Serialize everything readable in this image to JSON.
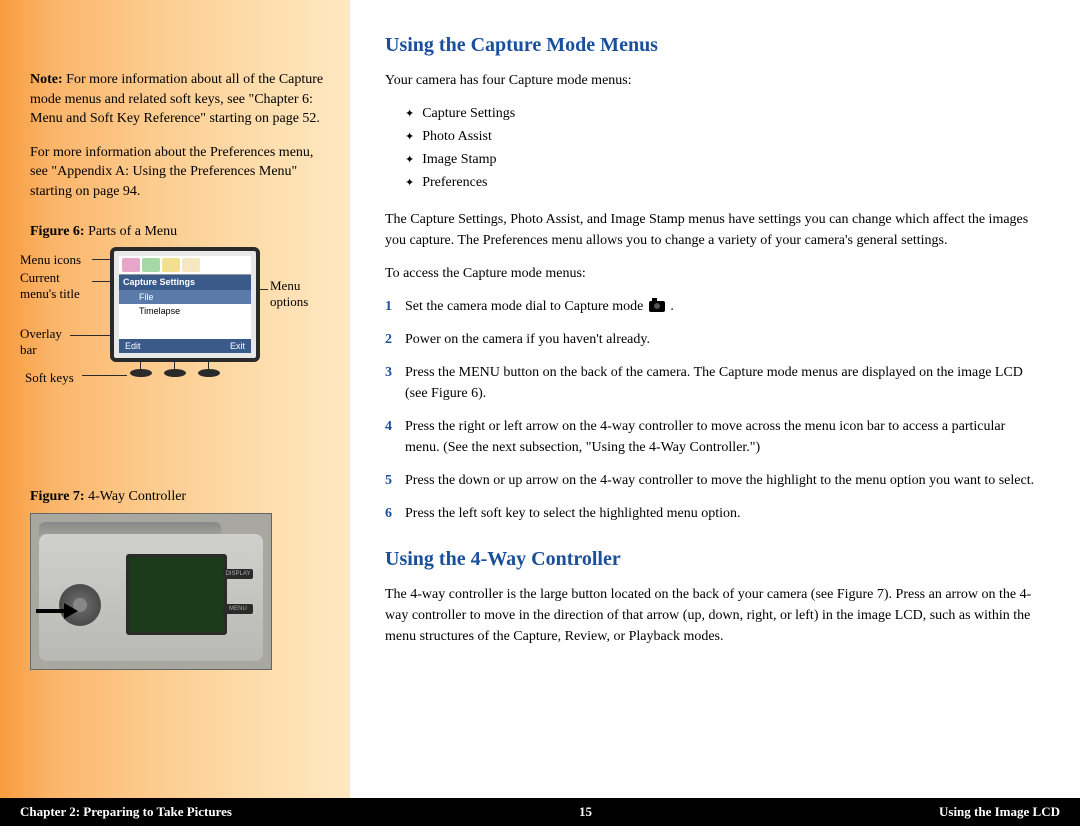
{
  "sidebar": {
    "note_label": "Note:",
    "note_text": " For more information about all of the Capture mode menus and related soft keys, see \"Chapter 6: Menu and Soft Key Reference\" starting on page 52.",
    "pref_text": "For more information about the Preferences menu, see \"Appendix A: Using the Preferences Menu\" starting on page 94.",
    "fig6_label": "Figure 6:",
    "fig6_caption": " Parts of a Menu",
    "labels": {
      "menu_icons": "Menu icons",
      "current_title_1": "Current",
      "current_title_2": "menu's title",
      "overlay_1": "Overlay",
      "overlay_2": "bar",
      "soft_keys": "Soft keys",
      "menu_1": "Menu",
      "menu_2": "options"
    },
    "lcd": {
      "title": "Capture Settings",
      "opt1": "File",
      "opt2": "Timelapse",
      "overlay_l": "Edit",
      "overlay_r": "Exit"
    },
    "fig7_label": "Figure 7:",
    "fig7_caption": " 4-Way Controller",
    "cam_btn1": "DISPLAY",
    "cam_btn2": "MENU"
  },
  "main": {
    "h1": "Using the Capture Mode Menus",
    "intro": "Your camera has four Capture mode menus:",
    "bullets": [
      "Capture Settings",
      "Photo Assist",
      "Image Stamp",
      "Preferences"
    ],
    "para1": "The Capture Settings, Photo Assist, and Image Stamp menus have settings you can change which affect the images you capture. The Preferences menu allows you to change a variety of your camera's general settings.",
    "access": "To access the Capture mode menus:",
    "steps": [
      "Set the camera mode dial to Capture mode",
      "Power on the camera if you haven't already.",
      "Press the MENU button on the back of the camera. The Capture mode menus are displayed on the image LCD (see Figure 6).",
      "Press the right or left arrow on the 4-way controller to move across the menu icon bar to access a particular menu. (See the next subsection, \"Using the 4-Way Controller.\")",
      "Press the down or up arrow on the 4-way controller to move the highlight to the menu option you want to select.",
      "Press the left soft key to select the highlighted menu option."
    ],
    "h2": "Using the 4-Way Controller",
    "para2": "The 4-way controller is the large button located on the back of your camera (see Figure 7). Press an arrow on the 4-way controller to move in the direction of that arrow (up, down, right, or left) in the image LCD, such as within the menu structures of the Capture, Review, or Playback modes."
  },
  "footer": {
    "left": "Chapter 2: Preparing to Take Pictures",
    "center": "15",
    "right": "Using the Image LCD"
  }
}
